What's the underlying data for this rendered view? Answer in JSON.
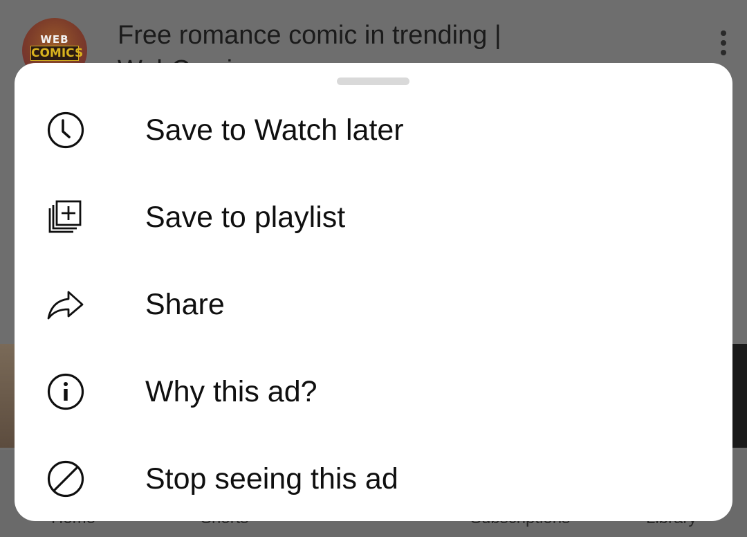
{
  "background": {
    "channel_avatar": {
      "line1": "WEB",
      "line2": "COMICS"
    },
    "video_title": "Free romance comic in trending | WebComics",
    "nav": [
      "Home",
      "Shorts",
      "",
      "Subscriptions",
      "Library"
    ]
  },
  "sheet": {
    "items": [
      {
        "label": "Save to Watch later",
        "icon": "clock-icon"
      },
      {
        "label": "Save to playlist",
        "icon": "playlist-add-icon"
      },
      {
        "label": "Share",
        "icon": "share-icon"
      },
      {
        "label": "Why this ad?",
        "icon": "info-icon"
      },
      {
        "label": "Stop seeing this ad",
        "icon": "block-icon"
      }
    ]
  },
  "colors": {
    "scrim": "#6e6e6e",
    "sheet_bg": "#ffffff",
    "text": "#0f0f0f",
    "handle": "#d9d9d9"
  }
}
